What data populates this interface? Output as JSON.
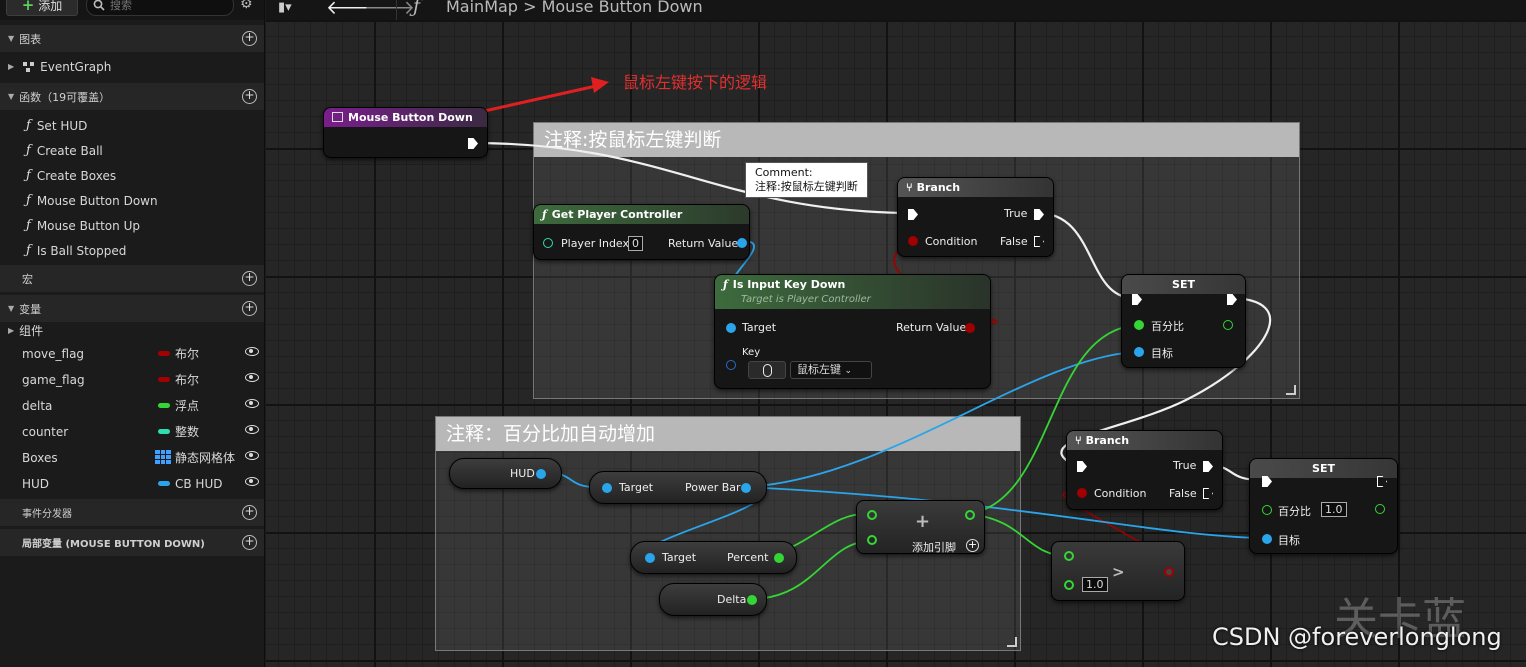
{
  "toolbar": {
    "add_label": "添加",
    "search_placeholder": "搜索"
  },
  "left": {
    "graphs_header": "图表",
    "event_graph": "EventGraph",
    "functions_header": "函数（19可覆盖）",
    "functions": [
      "Set HUD",
      "Create Ball",
      "Create Boxes",
      "Mouse Button Down",
      "Mouse Button Up",
      "Is Ball Stopped"
    ],
    "macros_header": "宏",
    "variables_header": "变量",
    "components_label": "组件",
    "variables": [
      {
        "name": "move_flag",
        "type": "布尔",
        "color": "#a30000"
      },
      {
        "name": "game_flag",
        "type": "布尔",
        "color": "#a30000"
      },
      {
        "name": "delta",
        "type": "浮点",
        "color": "#35d535"
      },
      {
        "name": "counter",
        "type": "整数",
        "color": "#2fdcae"
      },
      {
        "name": "Boxes",
        "type": "静态网格体",
        "color": "#3fa0ff"
      },
      {
        "name": "HUD",
        "type": "CB HUD",
        "color": "#2aa5ea"
      }
    ],
    "dispatchers_header": "事件分发器",
    "local_vars_header": "局部变量 (MOUSE BUTTON DOWN)"
  },
  "topbar": {
    "function_glyph": "ƒ",
    "breadcrumb_root": "MainMap",
    "breadcrumb_sep": ">",
    "breadcrumb_leaf": "Mouse Button Down"
  },
  "graph": {
    "annotation": "鼠标左键按下的逻辑",
    "comment1": "注释:按鼠标左键判断",
    "comment2": "注释：百分比加自动增加",
    "tooltip_title": "Comment:",
    "tooltip_body": "注释:按鼠标左键判断",
    "event_node": "Mouse Button Down",
    "gpc": {
      "title": "Get Player Controller",
      "player_index_label": "Player Index",
      "player_index": "0",
      "return_label": "Return Value"
    },
    "iikd": {
      "title": "Is Input Key Down",
      "subtitle": "Target is Player Controller",
      "target_label": "Target",
      "return_label": "Return Value",
      "key_label": "Key",
      "key_value": "鼠标左键"
    },
    "branch1": {
      "title": "Branch",
      "true_label": "True",
      "false_label": "False",
      "condition_label": "Condition"
    },
    "set1": {
      "title": "SET",
      "percent_label": "百分比",
      "target_label": "目标"
    },
    "hud_var": "HUD",
    "powerbar": {
      "target_label": "Target",
      "value_label": "Power Bar"
    },
    "percent": {
      "target_label": "Target",
      "value_label": "Percent"
    },
    "delta_var": "Delta",
    "add_node": {
      "label": "添加引脚"
    },
    "branch2": {
      "title": "Branch",
      "true_label": "True",
      "false_label": "False",
      "condition_label": "Condition"
    },
    "set2": {
      "title": "SET",
      "percent_label": "百分比",
      "percent_value": "1.0",
      "target_label": "目标"
    },
    "compare": {
      "value": "1.0",
      "op": ">"
    }
  },
  "watermark": {
    "faint": "关卡蓝",
    "credit": "CSDN @foreverlonglong"
  }
}
